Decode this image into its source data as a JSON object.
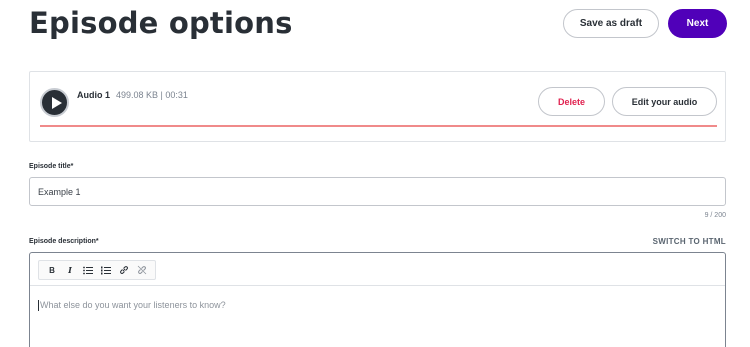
{
  "header": {
    "title": "Episode options",
    "save_draft_label": "Save as draft",
    "next_label": "Next"
  },
  "audio": {
    "name": "Audio 1",
    "meta": "499.08 KB | 00:31",
    "delete_label": "Delete",
    "edit_label": "Edit your audio",
    "progress": 1.0
  },
  "episode_title": {
    "label": "Episode title*",
    "value": "Example 1",
    "char_count": "9 / 200"
  },
  "episode_description": {
    "label": "Episode description*",
    "switch_label": "SWITCH TO HTML",
    "placeholder": "What else do you want your listeners to know?",
    "toolbar": {
      "bold_label": "B",
      "italic_label": "I",
      "icons": [
        "bold-icon",
        "italic-icon",
        "bulleted-list-icon",
        "numbered-list-icon",
        "link-icon",
        "unlink-icon"
      ]
    }
  },
  "colors": {
    "primary": "#5000b9",
    "danger": "#e0214f",
    "progress": "#f08a8a",
    "text": "#292f36"
  }
}
